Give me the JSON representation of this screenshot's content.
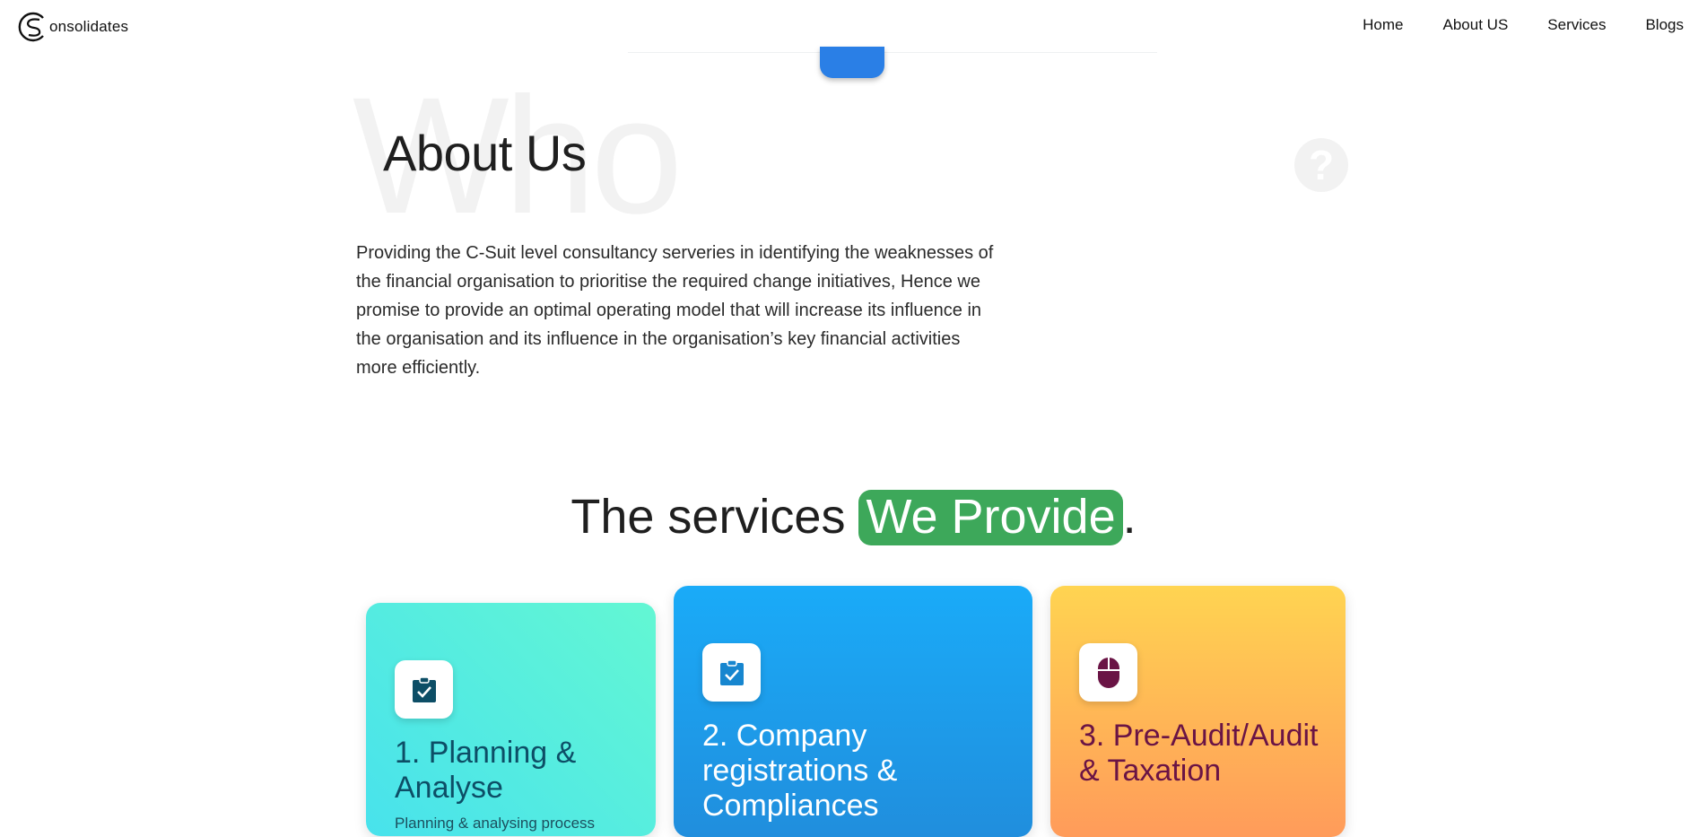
{
  "header": {
    "logo_text": "onsolidates",
    "nav": [
      "Home",
      "About US",
      "Services",
      "Blogs"
    ]
  },
  "about": {
    "background_word": "Who",
    "title": "About Us",
    "text": "Providing the C-Suit level consultancy serveries in identifying the weaknesses of the financial organisation to prioritise the required change initiatives, Hence we promise to provide an optimal operating model that will increase its influence in the organisation and its influence in the organisation’s key financial activities more efficiently.",
    "question_mark": "?"
  },
  "services": {
    "title_prefix": "The services",
    "title_highlight": "We Provide",
    "title_suffix": ".",
    "cards": [
      {
        "title": "1. Planning & Analyse",
        "description": "Planning & analysing process",
        "icon": "clipboard-check-icon"
      },
      {
        "title": "2. Company registrations & Compliances",
        "icon": "clipboard-check-icon"
      },
      {
        "title": "3. Pre-Audit/Audit & Taxation",
        "icon": "mouse-icon"
      }
    ]
  },
  "colors": {
    "accent_blue": "#2a7fe6",
    "highlight_green": "#3da85a",
    "card1_text": "#0d4e66",
    "card3_text": "#6a1445"
  }
}
